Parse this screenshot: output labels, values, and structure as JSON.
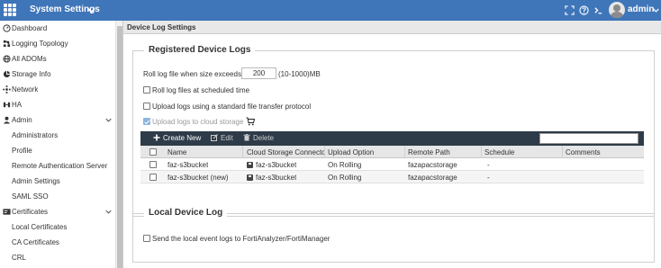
{
  "header": {
    "title": "System Settings",
    "user": "admin",
    "brand_color": "#3f75b9"
  },
  "sidebar": {
    "items": [
      {
        "label": "Dashboard",
        "icon": "dashboard-icon"
      },
      {
        "label": "Logging Topology",
        "icon": "topology-icon"
      },
      {
        "label": "All ADOMs",
        "icon": "globe-icon"
      },
      {
        "label": "Storage Info",
        "icon": "storage-icon"
      },
      {
        "label": "Network",
        "icon": "network-icon"
      },
      {
        "label": "HA",
        "icon": "ha-icon"
      },
      {
        "label": "Admin",
        "icon": "user-icon"
      },
      {
        "label": "Administrators"
      },
      {
        "label": "Profile"
      },
      {
        "label": "Remote Authentication Server"
      },
      {
        "label": "Admin Settings"
      },
      {
        "label": "SAML SSO"
      },
      {
        "label": "Certificates",
        "icon": "certificate-icon"
      },
      {
        "label": "Local Certificates"
      },
      {
        "label": "CA Certificates"
      },
      {
        "label": "CRL"
      }
    ]
  },
  "page": {
    "title": "Device Log Settings"
  },
  "registered": {
    "legend": "Registered Device Logs",
    "roll_label": "Roll log file when size exceeds",
    "roll_value": "200",
    "roll_unit": "(10-1000)MB",
    "opt_scheduled": "Roll log files at scheduled time",
    "opt_sftp": "Upload logs using a standard file transfer protocol",
    "opt_cloud": "Upload logs to cloud storage"
  },
  "toolbar": {
    "create": "Create New",
    "edit": "Edit",
    "delete": "Delete",
    "search_value": ""
  },
  "table": {
    "headers": [
      "Name",
      "Cloud Storage Connector",
      "Upload Option",
      "Remote Path",
      "Schedule",
      "Comments"
    ],
    "rows": [
      [
        "faz-s3bucket",
        "faz-s3bucket",
        "On Rolling",
        "fazapacstorage",
        "-",
        ""
      ],
      [
        "faz-s3bucket (new)",
        "faz-s3bucket",
        "On Rolling",
        "fazapacstorage",
        "-",
        ""
      ]
    ]
  },
  "local": {
    "legend": "Local Device Log",
    "opt_send": "Send the local event logs to FortiAnalyzer/FortiManager"
  }
}
